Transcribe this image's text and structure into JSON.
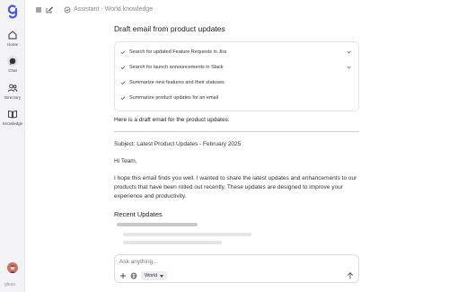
{
  "app": {
    "brand": "glean",
    "title": "Assistant - World knowledge"
  },
  "sidebar": {
    "items": [
      {
        "label": "Home",
        "icon": "home-icon"
      },
      {
        "label": "Chat",
        "icon": "chat-icon"
      },
      {
        "label": "Directory",
        "icon": "people-icon"
      },
      {
        "label": "Knowledge",
        "icon": "book-icon"
      }
    ]
  },
  "main": {
    "heading": "Draft email from product updates",
    "steps": [
      {
        "label": "Search for updated Feature Requests in Jira"
      },
      {
        "label": "Search for launch announcements in Slack"
      },
      {
        "label": "Summarize new features and their statuses"
      },
      {
        "label": "Summarize product updates for an email"
      }
    ],
    "intro": "Here is a draft email for the product updates:",
    "email": {
      "subject": "Subject: Latest Product Updates - February 2025",
      "greeting": "Hi Team,",
      "body_lines": [
        "I hope this email finds you well. I wanted to share the latest updates and enhancements to our",
        "products that have been rolled out recently. These updates are designed to improve your",
        "experience and productivity."
      ],
      "section_title": "Recent Updates"
    }
  },
  "composer": {
    "placeholder": "Ask anything...",
    "scope_label": "World"
  },
  "colors": {
    "sidebar_bg": "#f3f3f5",
    "brand": "#4b53d6",
    "text": "#222222"
  }
}
